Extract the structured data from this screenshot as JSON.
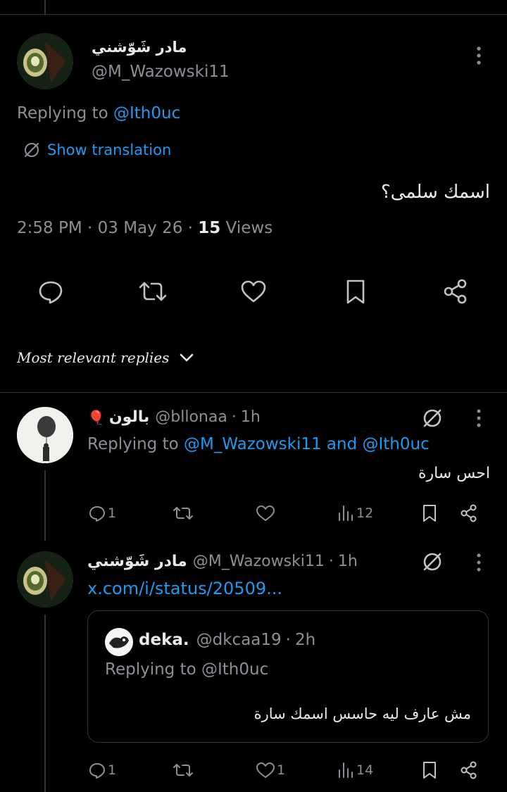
{
  "main_tweet": {
    "display_name": "مادر شَوّشني",
    "handle": "@M_Wazowski11",
    "replying_prefix": "Replying to",
    "replying_to": "@Ith0uc",
    "show_translation": "Show translation",
    "text": "اسمك سلمى؟",
    "time": "2:58 PM",
    "date": "03 May 26",
    "views_count": "15",
    "views_label": "Views"
  },
  "sort_label": "Most relevant replies",
  "replies": [
    {
      "display_name": "بالون",
      "emoji": "🎈",
      "handle": "@bllonaa",
      "age": "1h",
      "replying_prefix": "Replying to",
      "replying_to": "@M_Wazowski11 and @Ith0uc",
      "text": "احس سارة",
      "reply_count": "1",
      "like_count": "",
      "view_count": "12"
    },
    {
      "display_name": "مادر شَوّشني",
      "handle": "@M_Wazowski11",
      "age": "1h",
      "link": "x.com/i/status/20509...",
      "reply_count": "1",
      "like_count": "1",
      "view_count": "14",
      "quote": {
        "display_name": "deka.",
        "handle": "@dkcaa19",
        "age": "2h",
        "replying_prefix": "Replying to",
        "replying_to": "@Ith0uc",
        "text": "مش عارف ليه حاسس اسمك سارة"
      }
    }
  ],
  "colors": {
    "background": "#000000",
    "link": "#1d9bf0",
    "muted": "#71767b",
    "text": "#e7e9ea"
  }
}
